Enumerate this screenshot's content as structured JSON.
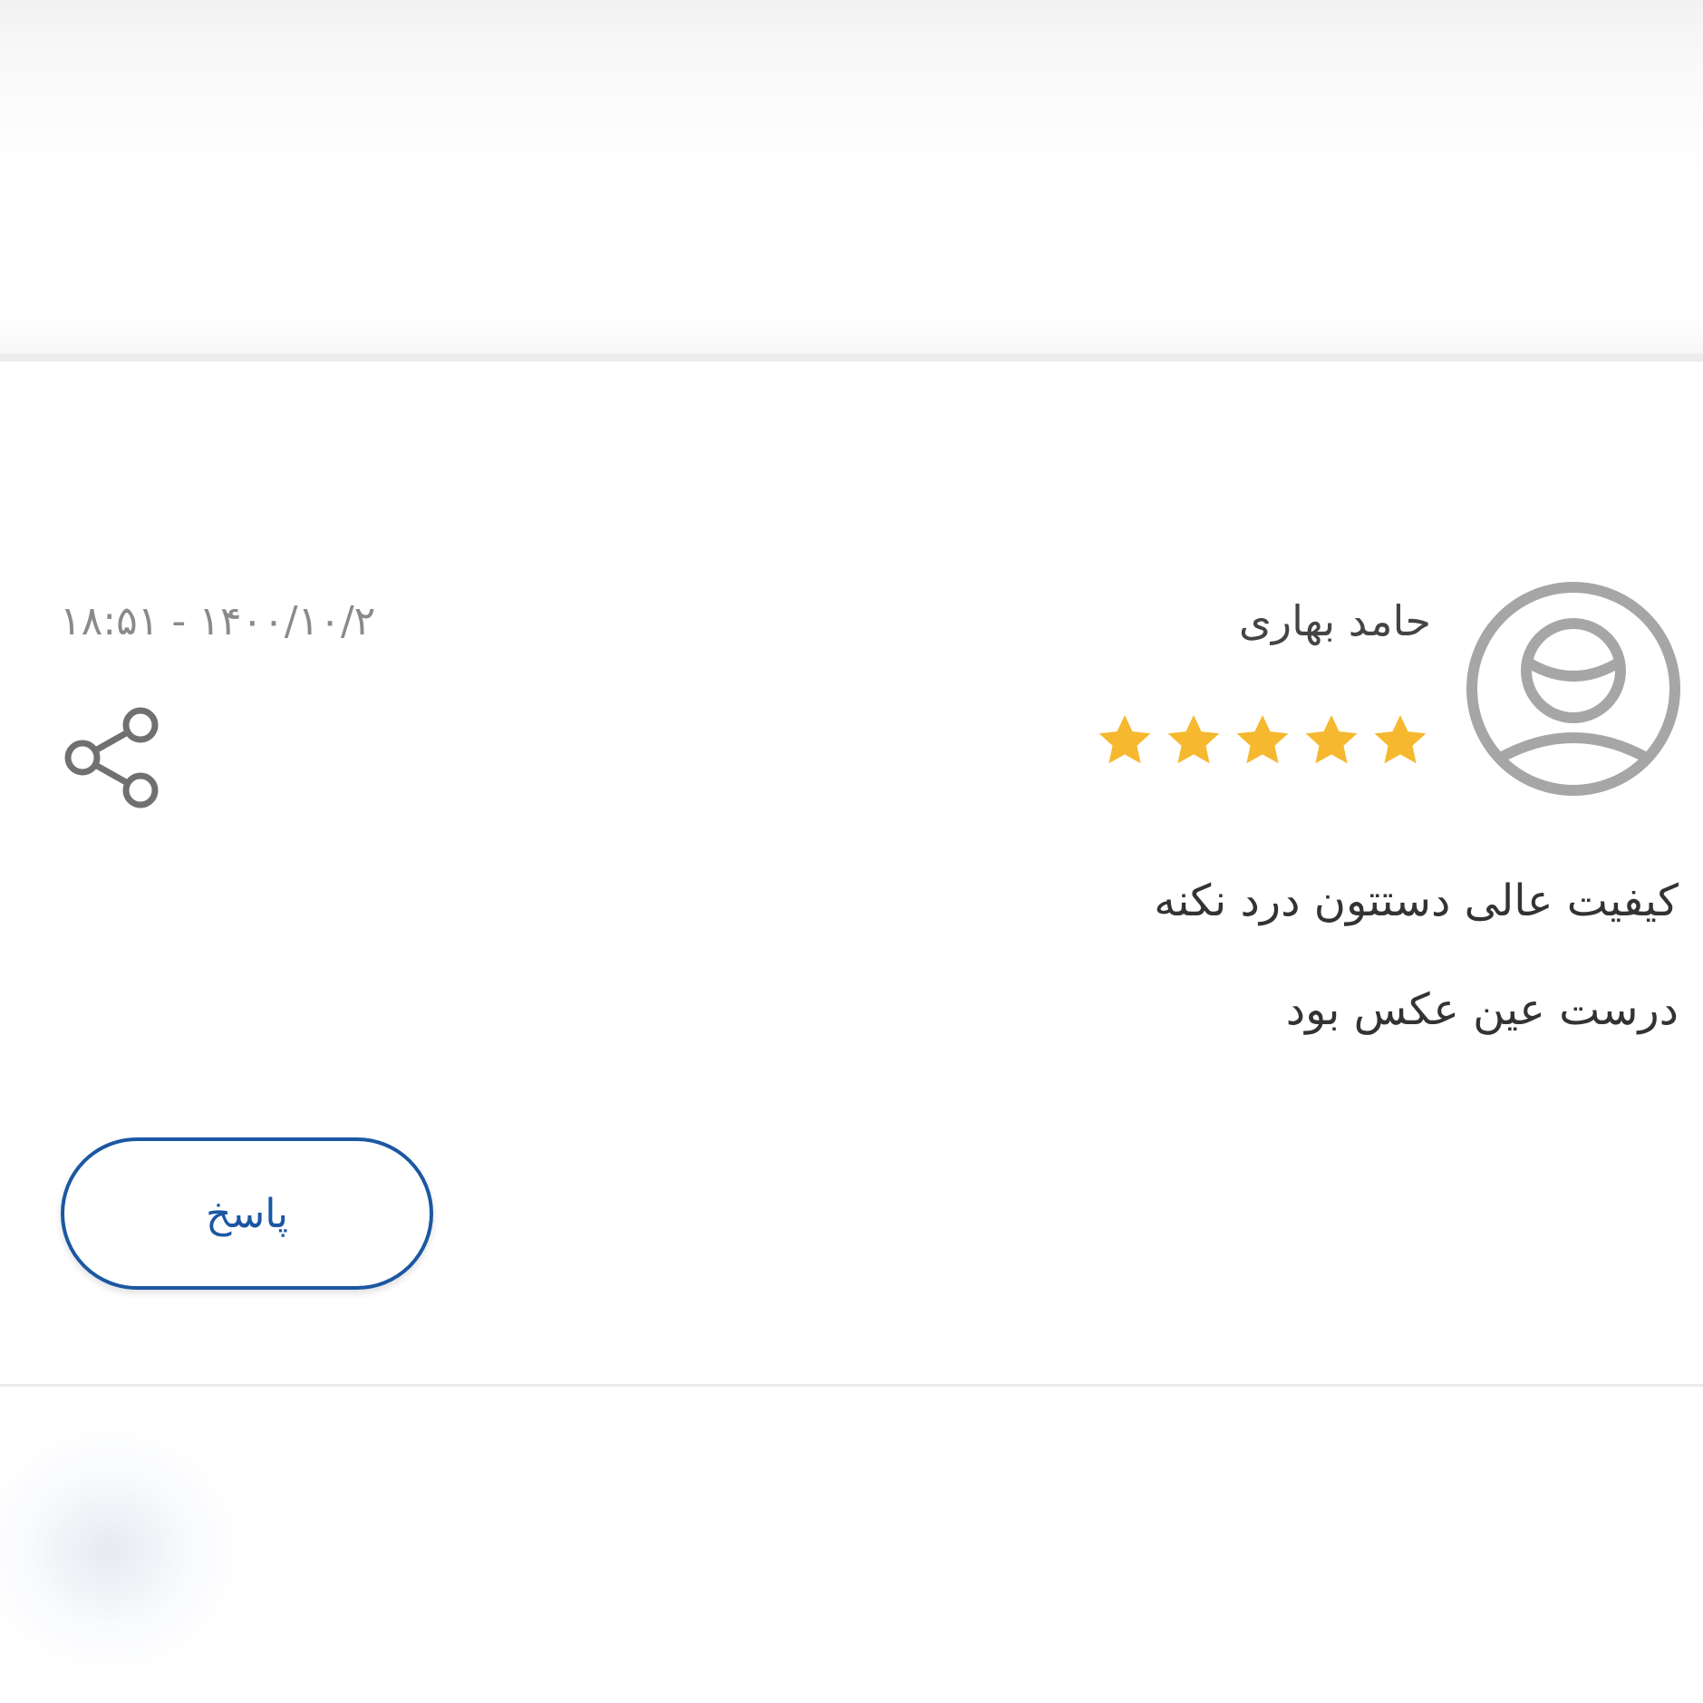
{
  "review": {
    "reviewer_name": "حامد بهاری",
    "timestamp": "۱۸:۵۱ - ۱۴۰۰/۱۰/۲",
    "rating": 5,
    "rating_max": 5,
    "comment_lines": [
      "کیفیت عالی دستتون درد نکنه",
      "درست عین عکس بود"
    ],
    "reply_label": "پاسخ",
    "icons": {
      "avatar": "user-avatar-icon",
      "share": "share-icon",
      "star": "star-icon"
    }
  },
  "colors": {
    "accent": "#1b57a3",
    "star": "#f5b82e",
    "icon_gray": "#a6a6a6",
    "share_gray": "#707070",
    "text_dark": "#333333",
    "text_muted": "#8a8a8a"
  }
}
